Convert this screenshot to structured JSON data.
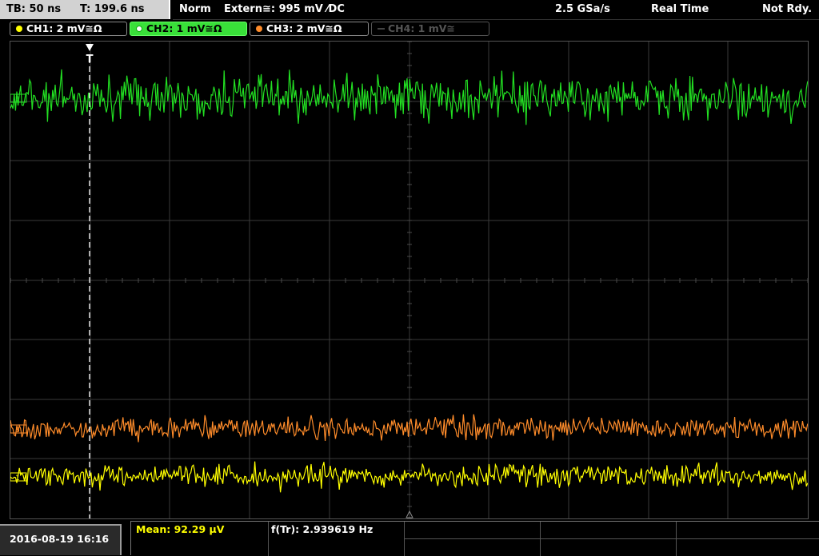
{
  "timebase": {
    "tb": "TB: 50 ns",
    "trigger_time": "T: 199.6 ns"
  },
  "status": {
    "mode": "Norm",
    "trigger_source": "Extern≅: 995 mV ⁄DC",
    "sample_rate": "2.5 GSa/s",
    "acquisition": "Real Time",
    "state": "Not Rdy."
  },
  "channels": [
    {
      "label": "CH1: 2 mV≅Ω",
      "color": "#ffff00"
    },
    {
      "label": "CH2: 1 mV≅Ω",
      "color": "#ffffff"
    },
    {
      "label": "CH3: 2 mV≅Ω",
      "color": "#ff8c2a"
    },
    {
      "label": "CH4: 1 mV≅",
      "color": "#555555"
    }
  ],
  "traces": {
    "ch1": {
      "color": "#ffff00",
      "marker": "1"
    },
    "ch2": {
      "color": "#22e022",
      "marker": "2"
    },
    "ch3": {
      "color": "#ff8c2a",
      "marker": "3"
    }
  },
  "trigger_marker": "T",
  "datetime": "2016-08-19 16:16",
  "measurements": {
    "mean": "Mean: 92.29 µV",
    "frequency": "f(Tr): 2.939619 Hz"
  }
}
